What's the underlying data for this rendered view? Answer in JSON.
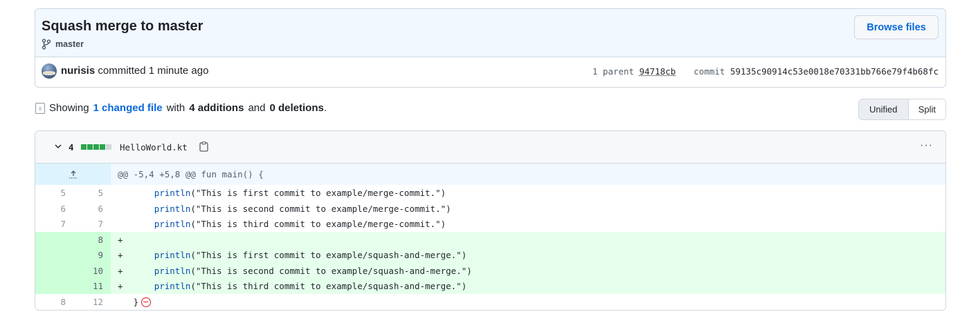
{
  "commit": {
    "title": "Squash merge to master",
    "branch": "master",
    "browse_label": "Browse files",
    "author": "nurisis",
    "committed_text": "committed 1 minute ago",
    "parent_label": "1 parent",
    "parent_sha": "94718cb",
    "commit_label": "commit",
    "commit_sha": "59135c90914c53e0018e70331bb766e79f4b68fc"
  },
  "summary": {
    "showing": "Showing",
    "changed_files": "1 changed file",
    "with": "with",
    "additions": "4 additions",
    "and": "and",
    "deletions": "0 deletions",
    "period": "."
  },
  "view_toggle": {
    "unified": "Unified",
    "split": "Split",
    "active": "Unified"
  },
  "file": {
    "change_count": "4",
    "filename": "HelloWorld.kt",
    "hunk_header": "@@ -5,4 +5,8 @@ fun main() {",
    "lines": [
      {
        "type": "context",
        "old": "5",
        "new": "5",
        "marker": " ",
        "indent": "      ",
        "fn": "println",
        "rest": "(\"This is first commit to example/merge-commit.\")"
      },
      {
        "type": "context",
        "old": "6",
        "new": "6",
        "marker": " ",
        "indent": "      ",
        "fn": "println",
        "rest": "(\"This is second commit to example/merge-commit.\")"
      },
      {
        "type": "context",
        "old": "7",
        "new": "7",
        "marker": " ",
        "indent": "      ",
        "fn": "println",
        "rest": "(\"This is third commit to example/merge-commit.\")"
      },
      {
        "type": "add",
        "old": "",
        "new": "8",
        "marker": "+",
        "indent": "",
        "fn": "",
        "rest": ""
      },
      {
        "type": "add",
        "old": "",
        "new": "9",
        "marker": "+",
        "indent": "      ",
        "fn": "println",
        "rest": "(\"This is first commit to example/squash-and-merge.\")"
      },
      {
        "type": "add",
        "old": "",
        "new": "10",
        "marker": "+",
        "indent": "      ",
        "fn": "println",
        "rest": "(\"This is second commit to example/squash-and-merge.\")"
      },
      {
        "type": "add",
        "old": "",
        "new": "11",
        "marker": "+",
        "indent": "      ",
        "fn": "println",
        "rest": "(\"This is third commit to example/squash-and-merge.\")"
      },
      {
        "type": "context",
        "old": "8",
        "new": "12",
        "marker": " ",
        "indent": "  ",
        "fn": "",
        "rest": "}"
      }
    ]
  },
  "icons": {
    "branch": "git-branch-icon",
    "diff": "file-diff-icon",
    "chevron": "chevron-down-icon",
    "clipboard": "clipboard-icon",
    "kebab": "kebab-horizontal-icon",
    "expand": "expand-up-icon",
    "no_newline": "no-newline-icon"
  },
  "colors": {
    "accent": "#0969da",
    "addition_bg": "#e6ffec",
    "addition_gutter": "#ccffd8",
    "addition_block": "#2da44e",
    "no_newline": "#cf222e"
  }
}
